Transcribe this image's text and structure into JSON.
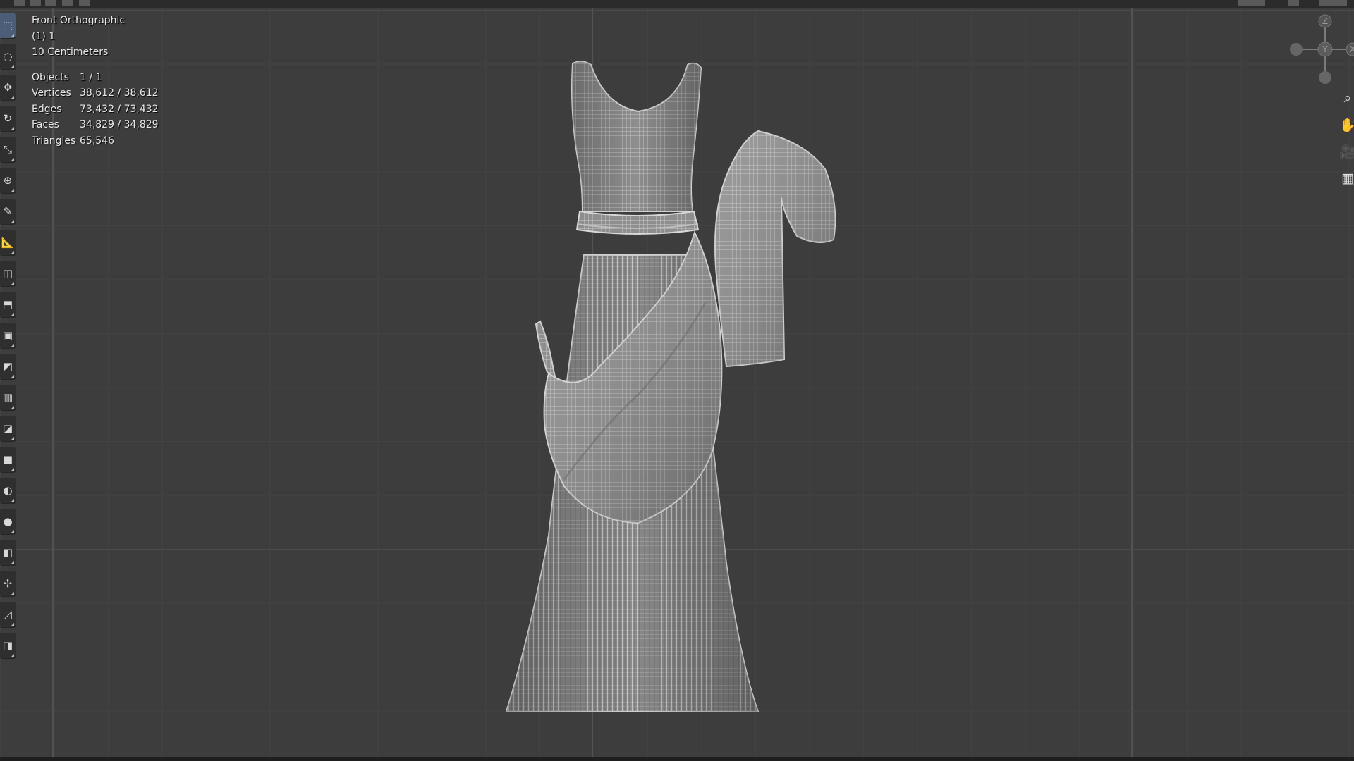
{
  "viewport": {
    "view_name": "Front Orthographic",
    "collection": "(1) 1",
    "grid_scale": "10 Centimeters"
  },
  "stats": [
    {
      "label": "Objects",
      "value": "1 / 1"
    },
    {
      "label": "Vertices",
      "value": "38,612 / 38,612"
    },
    {
      "label": "Edges",
      "value": "73,432 / 73,432"
    },
    {
      "label": "Faces",
      "value": "34,829 / 34,829"
    },
    {
      "label": "Triangles",
      "value": "65,546"
    }
  ],
  "gizmo": {
    "z": "Z",
    "y": "Y",
    "x": "X"
  },
  "toolbar": [
    {
      "name": "select-box-tool",
      "glyph": "⬚"
    },
    {
      "name": "cursor-tool",
      "glyph": "◌"
    },
    {
      "name": "move-tool",
      "glyph": "✥"
    },
    {
      "name": "rotate-tool",
      "glyph": "↻"
    },
    {
      "name": "scale-tool",
      "glyph": "⤡"
    },
    {
      "name": "transform-tool",
      "glyph": "⊕"
    },
    {
      "name": "annotate-tool",
      "glyph": "✎"
    },
    {
      "name": "measure-tool",
      "glyph": "📐"
    },
    {
      "name": "add-cube-tool",
      "glyph": "◫"
    },
    {
      "name": "extrude-tool",
      "glyph": "⬒"
    },
    {
      "name": "inset-tool",
      "glyph": "▣"
    },
    {
      "name": "bevel-tool",
      "glyph": "◩"
    },
    {
      "name": "loop-cut-tool",
      "glyph": "▥"
    },
    {
      "name": "knife-tool",
      "glyph": "◪"
    },
    {
      "name": "poly-build-tool",
      "glyph": "■"
    },
    {
      "name": "spin-tool",
      "glyph": "◐"
    },
    {
      "name": "smooth-tool",
      "glyph": "●"
    },
    {
      "name": "edge-slide-tool",
      "glyph": "◧"
    },
    {
      "name": "shrink-fatten-tool",
      "glyph": "✢"
    },
    {
      "name": "shear-tool",
      "glyph": "◿"
    },
    {
      "name": "rip-tool",
      "glyph": "◨"
    }
  ],
  "navigation": [
    {
      "name": "zoom-icon",
      "glyph": "⌕"
    },
    {
      "name": "pan-hand-icon",
      "glyph": "✋"
    },
    {
      "name": "camera-icon",
      "glyph": "🎥"
    },
    {
      "name": "grid-view-icon",
      "glyph": "▦"
    }
  ],
  "colors": {
    "background": "#3d3d3d",
    "mesh": "#9a9a9a",
    "wire": "#c8c8c8",
    "gizmo_axis": "#7a7a7a"
  }
}
